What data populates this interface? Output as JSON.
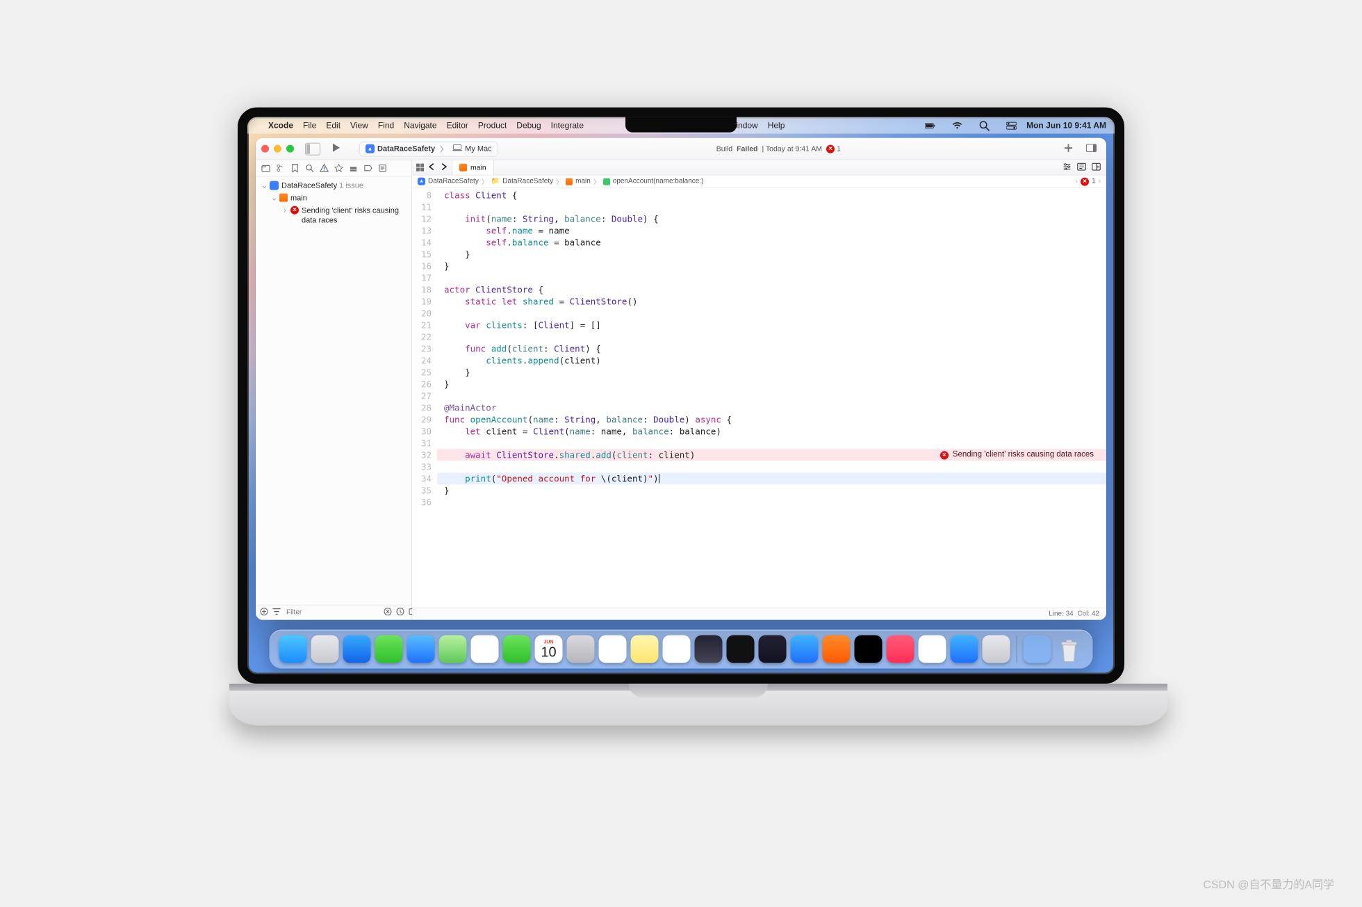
{
  "watermark": "CSDN @自不量力的A同学",
  "menubar": {
    "app": "Xcode",
    "items": [
      "File",
      "Edit",
      "View",
      "Find",
      "Navigate",
      "Editor",
      "Product",
      "Debug",
      "Integrate"
    ],
    "notch_after": [
      "Window",
      "Help"
    ],
    "clock": "Mon Jun 10  9:41 AM"
  },
  "toolbar": {
    "scheme_name": "DataRaceSafety",
    "destination": "My Mac",
    "build_status_prefix": "Build ",
    "build_status_failed": "Failed",
    "build_status_time": " | Today at 9:41 AM",
    "error_count": "1"
  },
  "navigator": {
    "project": "DataRaceSafety",
    "issue_suffix": " 1 issue",
    "file": "main",
    "error": "Sending 'client' risks causing data races",
    "filter_placeholder": "Filter"
  },
  "tabbar": {
    "active_tab": "main"
  },
  "breadcrumbs": {
    "c1": "DataRaceSafety",
    "c2": "DataRaceSafety",
    "c3": "main",
    "c4": "openAccount(name:balance:)",
    "err": "1"
  },
  "code": {
    "lines": [
      {
        "n": 8,
        "html": "<span class='k'>class</span> <span class='t'>Client</span> {"
      },
      {
        "n": 11,
        "html": ""
      },
      {
        "n": 12,
        "html": "    <span class='k'>init</span>(<span class='p'>name</span>: <span class='t'>String</span>, <span class='p'>balance</span>: <span class='t'>Double</span>) {"
      },
      {
        "n": 13,
        "html": "        <span class='k'>self</span>.<span class='m'>name</span> = name"
      },
      {
        "n": 14,
        "html": "        <span class='k'>self</span>.<span class='m'>balance</span> = balance"
      },
      {
        "n": 15,
        "html": "    }"
      },
      {
        "n": 16,
        "html": "}"
      },
      {
        "n": 17,
        "html": ""
      },
      {
        "n": 18,
        "html": "<span class='k'>actor</span> <span class='t'>ClientStore</span> {"
      },
      {
        "n": 19,
        "html": "    <span class='k'>static</span> <span class='k'>let</span> <span class='m'>shared</span> = <span class='t'>ClientStore</span>()"
      },
      {
        "n": 20,
        "html": ""
      },
      {
        "n": 21,
        "html": "    <span class='k'>var</span> <span class='m'>clients</span>: [<span class='t'>Client</span>] = []"
      },
      {
        "n": 22,
        "html": ""
      },
      {
        "n": 23,
        "html": "    <span class='k'>func</span> <span class='m'>add</span>(<span class='p'>client</span>: <span class='t'>Client</span>) {"
      },
      {
        "n": 24,
        "html": "        <span class='m'>clients</span>.<span class='m'>append</span>(client)"
      },
      {
        "n": 25,
        "html": "    }"
      },
      {
        "n": 26,
        "html": "}"
      },
      {
        "n": 27,
        "html": ""
      },
      {
        "n": 28,
        "html": "<span class='a'>@MainActor</span>"
      },
      {
        "n": 29,
        "html": "<span class='k'>func</span> <span class='m'>openAccount</span>(<span class='p'>name</span>: <span class='t'>String</span>, <span class='p'>balance</span>: <span class='t'>Double</span>) <span class='k'>async</span> {"
      },
      {
        "n": 30,
        "html": "    <span class='k'>let</span> client = <span class='t'>Client</span>(<span class='p'>name</span>: name, <span class='p'>balance</span>: balance)"
      },
      {
        "n": 31,
        "html": ""
      },
      {
        "n": 32,
        "html": "    <span class='k'>await</span> <span class='t'>ClientStore</span>.<span class='m'>shared</span>.<span class='m'>add</span>(<span class='p'>client</span>: client)",
        "err": true
      },
      {
        "n": 33,
        "html": ""
      },
      {
        "n": 34,
        "html": "    <span class='m'>print</span>(<span class='s'>\"Opened account for </span>\\(client)<span class='s'>\"</span>)<span class='caret'></span>",
        "sel": true
      },
      {
        "n": 35,
        "html": "}"
      },
      {
        "n": 36,
        "html": ""
      }
    ],
    "inline_error": "Sending 'client' risks causing data races"
  },
  "statusline": {
    "line": "Line: 34",
    "col": "Col: 42"
  },
  "dock": {
    "cal_day": "JUN",
    "cal_num": "10",
    "icons": [
      {
        "name": "finder",
        "g": "linear-gradient(#4bc7ff,#1e8bff)"
      },
      {
        "name": "launchpad",
        "g": "linear-gradient(#e7e8ec,#c9cad0)"
      },
      {
        "name": "safari",
        "g": "linear-gradient(#38a9ff,#1263e6)"
      },
      {
        "name": "messages",
        "g": "linear-gradient(#6be35a,#2fbf2c)"
      },
      {
        "name": "mail",
        "g": "linear-gradient(#59bdff,#1f72ff)"
      },
      {
        "name": "maps",
        "g": "linear-gradient(#b8f0a0,#60c95a)"
      },
      {
        "name": "photos",
        "g": "#fff"
      },
      {
        "name": "facetime",
        "g": "linear-gradient(#6be35a,#2fbf2c)"
      },
      {
        "name": "calendar",
        "cal": true
      },
      {
        "name": "contacts",
        "g": "linear-gradient(#d8d8dd,#b6b6bc)"
      },
      {
        "name": "reminders",
        "g": "#fff"
      },
      {
        "name": "notes",
        "g": "linear-gradient(#fff6b0,#ffe56f)"
      },
      {
        "name": "freeform",
        "g": "#fff"
      },
      {
        "name": "image-playground",
        "g": "linear-gradient(#223,#445)"
      },
      {
        "name": "tv",
        "g": "#111"
      },
      {
        "name": "xcode",
        "g": "linear-gradient(#223,#112)"
      },
      {
        "name": "appstore",
        "g": "linear-gradient(#40b4ff,#1f6fff)"
      },
      {
        "name": "swift-playgrounds",
        "g": "linear-gradient(#ff8a2a,#ff5a00)"
      },
      {
        "name": "appletv",
        "g": "#000"
      },
      {
        "name": "music",
        "g": "linear-gradient(#ff5a7a,#ff2d55)"
      },
      {
        "name": "news",
        "g": "#fff"
      },
      {
        "name": "appstore2",
        "g": "linear-gradient(#40b4ff,#1f6fff)"
      },
      {
        "name": "settings",
        "g": "linear-gradient(#e7e8ec,#c9cad0)"
      }
    ]
  }
}
